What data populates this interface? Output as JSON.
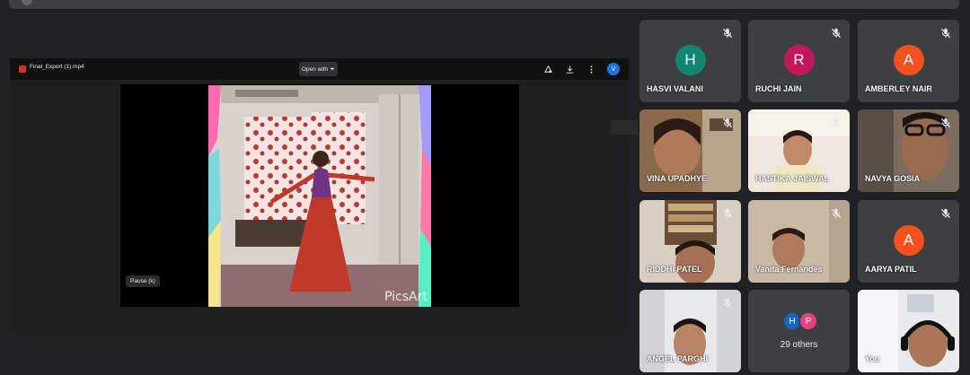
{
  "presentation": {
    "file_name": "Final_Export (1).mp4",
    "open_with_label": "Open with",
    "viewer_avatar": "V",
    "pause_tooltip": "Pause (k)",
    "watermark": "PicsArt"
  },
  "participants": [
    {
      "name": "HASVI VALANI",
      "initial": "H",
      "color": "#12876f",
      "muted": true
    },
    {
      "name": "RUCHI JAIN",
      "initial": "R",
      "color": "#c2185b",
      "muted": true
    },
    {
      "name": "AMBERLEY NAIR",
      "initial": "A",
      "color": "#f4511e",
      "muted": true
    },
    {
      "name": "VINA UPADHYE",
      "muted": true,
      "video": true
    },
    {
      "name": "HASTIKA JAISWAL",
      "muted": true,
      "video": true
    },
    {
      "name": "NAVYA GOSIA",
      "muted": true,
      "video": true
    },
    {
      "name": "RIDDHI PATEL",
      "muted": true,
      "video": true
    },
    {
      "name": "Vanita Fernandes",
      "muted": true,
      "video": true
    },
    {
      "name": "AARYA PATIL",
      "initial": "A",
      "color": "#f4511e",
      "muted": true
    },
    {
      "name": "ANGEL PARGHI",
      "muted": true,
      "video": true
    },
    {
      "name": "You",
      "video": true
    }
  ],
  "others_tile": {
    "label": "29 others",
    "avatars": [
      {
        "initial": "H",
        "color": "#1565c0"
      },
      {
        "initial": "P",
        "color": "#ec407a"
      }
    ]
  },
  "colors": {
    "background": "#202124",
    "tile": "#3c4043",
    "accent": "#1a73e8"
  }
}
